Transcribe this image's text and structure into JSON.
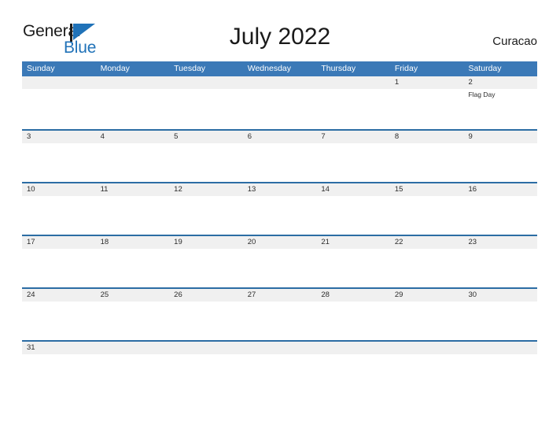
{
  "brand": {
    "name_part1": "General",
    "name_part2": "Blue",
    "color_dark": "#1c1c1c",
    "color_blue": "#2072b8"
  },
  "header": {
    "title": "July 2022",
    "region": "Curacao"
  },
  "theme": {
    "header_blue": "#3b79b7",
    "row_rule_blue": "#2c6da4",
    "day_band_gray": "#f0f0f0",
    "text_dark": "#2b2b2b"
  },
  "calendar": {
    "weekdays": [
      "Sunday",
      "Monday",
      "Tuesday",
      "Wednesday",
      "Thursday",
      "Friday",
      "Saturday"
    ],
    "weeks": [
      {
        "days": [
          {
            "num": "",
            "events": []
          },
          {
            "num": "",
            "events": []
          },
          {
            "num": "",
            "events": []
          },
          {
            "num": "",
            "events": []
          },
          {
            "num": "",
            "events": []
          },
          {
            "num": "1",
            "events": []
          },
          {
            "num": "2",
            "events": [
              "Flag Day"
            ]
          }
        ]
      },
      {
        "days": [
          {
            "num": "3",
            "events": []
          },
          {
            "num": "4",
            "events": []
          },
          {
            "num": "5",
            "events": []
          },
          {
            "num": "6",
            "events": []
          },
          {
            "num": "7",
            "events": []
          },
          {
            "num": "8",
            "events": []
          },
          {
            "num": "9",
            "events": []
          }
        ]
      },
      {
        "days": [
          {
            "num": "10",
            "events": []
          },
          {
            "num": "11",
            "events": []
          },
          {
            "num": "12",
            "events": []
          },
          {
            "num": "13",
            "events": []
          },
          {
            "num": "14",
            "events": []
          },
          {
            "num": "15",
            "events": []
          },
          {
            "num": "16",
            "events": []
          }
        ]
      },
      {
        "days": [
          {
            "num": "17",
            "events": []
          },
          {
            "num": "18",
            "events": []
          },
          {
            "num": "19",
            "events": []
          },
          {
            "num": "20",
            "events": []
          },
          {
            "num": "21",
            "events": []
          },
          {
            "num": "22",
            "events": []
          },
          {
            "num": "23",
            "events": []
          }
        ]
      },
      {
        "days": [
          {
            "num": "24",
            "events": []
          },
          {
            "num": "25",
            "events": []
          },
          {
            "num": "26",
            "events": []
          },
          {
            "num": "27",
            "events": []
          },
          {
            "num": "28",
            "events": []
          },
          {
            "num": "29",
            "events": []
          },
          {
            "num": "30",
            "events": []
          }
        ]
      },
      {
        "days": [
          {
            "num": "31",
            "events": []
          },
          {
            "num": "",
            "events": []
          },
          {
            "num": "",
            "events": []
          },
          {
            "num": "",
            "events": []
          },
          {
            "num": "",
            "events": []
          },
          {
            "num": "",
            "events": []
          },
          {
            "num": "",
            "events": []
          }
        ]
      }
    ]
  }
}
